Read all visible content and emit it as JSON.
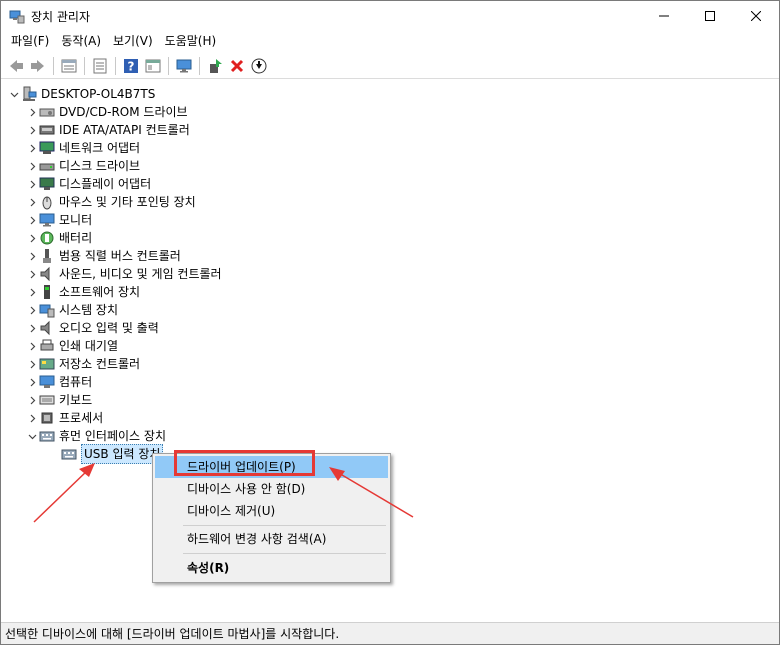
{
  "window": {
    "title": "장치 관리자"
  },
  "menu": [
    "파일(F)",
    "동작(A)",
    "보기(V)",
    "도움말(H)"
  ],
  "toolbar": {
    "buttons": [
      "back-arrow-icon",
      "forward-arrow-icon",
      "properties-icon",
      "list-view-icon",
      "help-icon",
      "resource-view-icon",
      "monitor-scan-icon",
      "add-driver-icon",
      "uninstall-x-icon",
      "download-arrow-icon"
    ]
  },
  "tree": {
    "root": "DESKTOP-OL4B7TS",
    "items": [
      "DVD/CD-ROM 드라이브",
      "IDE ATA/ATAPI 컨트롤러",
      "네트워크 어댑터",
      "디스크 드라이브",
      "디스플레이 어댑터",
      "마우스 및 기타 포인팅 장치",
      "모니터",
      "배터리",
      "범용 직렬 버스 컨트롤러",
      "사운드, 비디오 및 게임 컨트롤러",
      "소프트웨어 장치",
      "시스템 장치",
      "오디오 입력 및 출력",
      "인쇄 대기열",
      "저장소 컨트롤러",
      "컴퓨터",
      "키보드",
      "프로세서",
      "휴먼 인터페이스 장치"
    ],
    "child": "USB 입력 장치"
  },
  "context_menu": {
    "items": [
      "드라이버 업데이트(P)",
      "디바이스 사용 안 함(D)",
      "디바이스 제거(U)",
      "하드웨어 변경 사항 검색(A)",
      "속성(R)"
    ]
  },
  "status": "선택한 디바이스에 대해 [드라이버 업데이트 마법사]를 시작합니다.",
  "colors": {
    "highlight": "#91c9f7",
    "annotation": "#e53935",
    "selection": "#cce8ff"
  }
}
